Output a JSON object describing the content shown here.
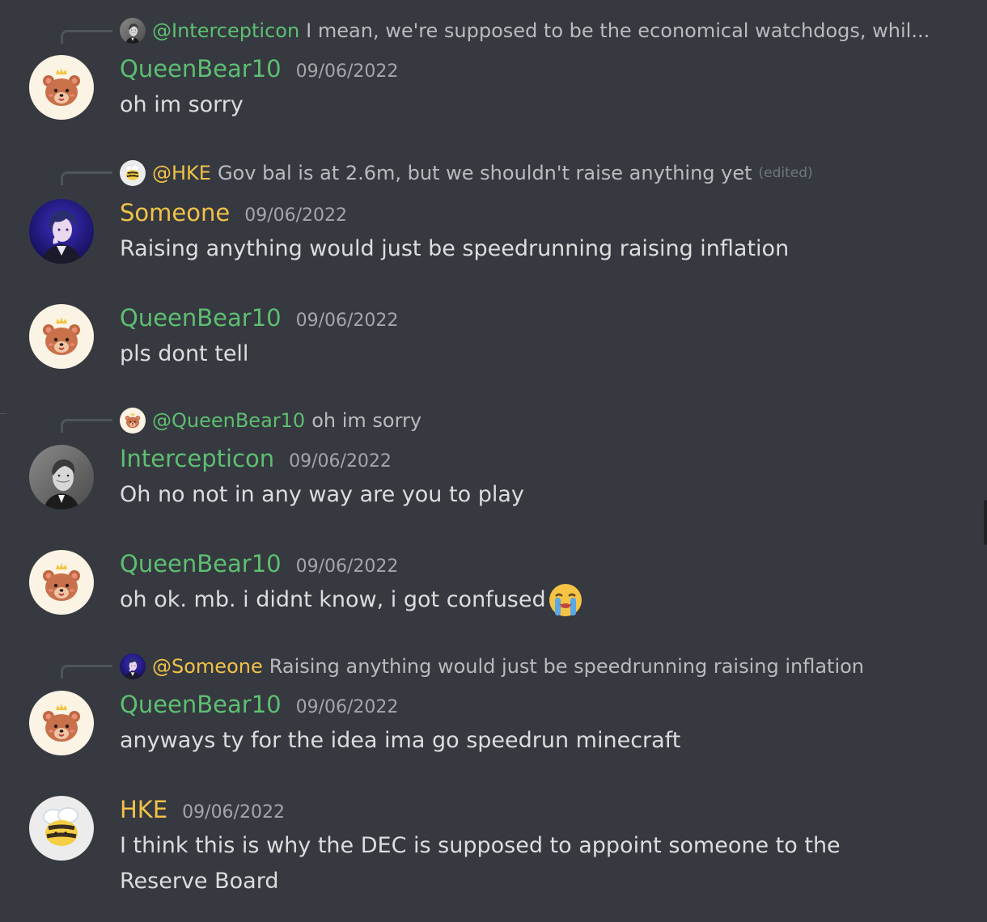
{
  "messages": [
    {
      "reply": {
        "user": "@Intercepticon",
        "text": "I mean, we're supposed to be the economical watchdogs, whil...",
        "avatar": "man-portrait-avatar"
      },
      "user": "QueenBear10",
      "time": "09/06/2022",
      "lines": [
        "oh im sorry"
      ],
      "avatar": "bear-avatar"
    },
    {
      "reply": {
        "user": "@HKE",
        "text": "Gov bal is at 2.6m, but we shouldn't raise anything yet",
        "edited": "(edited)",
        "avatar": "bee-avatar"
      },
      "user": "Someone",
      "time": "09/06/2022",
      "lines": [
        "Raising anything would just be speedrunning raising inflation"
      ],
      "avatar": "anime-avatar"
    },
    {
      "user": "QueenBear10",
      "time": "09/06/2022",
      "lines": [
        "pls dont tell"
      ],
      "avatar": "bear-avatar"
    },
    {
      "reply": {
        "user": "@QueenBear10",
        "text": "oh im sorry",
        "avatar": "bear-avatar"
      },
      "user": "Intercepticon",
      "time": "09/06/2022",
      "lines": [
        "Oh no not in any way are you to play"
      ],
      "avatar": "man-portrait-avatar"
    },
    {
      "user": "QueenBear10",
      "time": "09/06/2022",
      "lines": [
        "oh ok. mb. i didnt know, i got confused"
      ],
      "emoji": "loudly-crying-emoji",
      "avatar": "bear-avatar"
    },
    {
      "reply": {
        "user": "@Someone",
        "text": "Raising anything would just be speedrunning raising inflation",
        "avatar": "anime-avatar"
      },
      "user": "QueenBear10",
      "time": "09/06/2022",
      "lines": [
        "anyways ty for the idea ima go speedrun minecraft"
      ],
      "avatar": "bear-avatar"
    },
    {
      "user": "HKE",
      "time": "09/06/2022",
      "lines": [
        "I think this is why the DEC is supposed to appoint someone to the",
        "Reserve Board"
      ],
      "avatar": "bee-avatar"
    }
  ],
  "colors": {
    "background": "#36393f",
    "green_role": "#5dbf72",
    "gold_role": "#f0c248",
    "message_text": "#dcddde",
    "timestamp": "#a3a6aa"
  }
}
